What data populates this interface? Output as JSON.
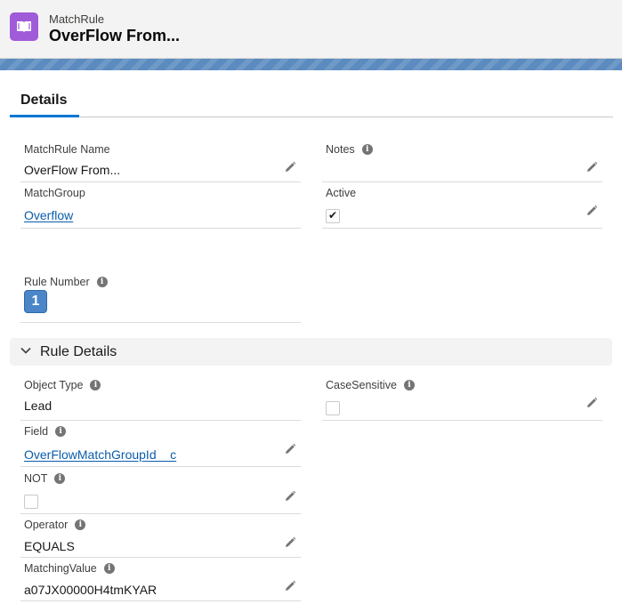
{
  "header": {
    "object_type": "MatchRule",
    "title": "OverFlow From..."
  },
  "tabs": {
    "details": "Details"
  },
  "fields": {
    "matchrule_name": {
      "label": "MatchRule Name",
      "value": "OverFlow From..."
    },
    "notes": {
      "label": "Notes",
      "value": ""
    },
    "matchgroup": {
      "label": "MatchGroup",
      "value": "Overflow"
    },
    "active": {
      "label": "Active",
      "checked": true
    },
    "rule_number": {
      "label": "Rule Number",
      "value": "1"
    }
  },
  "section": {
    "title": "Rule Details",
    "expanded": true
  },
  "rule_details": {
    "object_type": {
      "label": "Object Type",
      "value": "Lead"
    },
    "case_sensitive": {
      "label": "CaseSensitive",
      "checked": false
    },
    "field": {
      "label": "Field",
      "value": "OverFlowMatchGroupId__c"
    },
    "not": {
      "label": "NOT",
      "checked": false
    },
    "operator": {
      "label": "Operator",
      "value": "EQUALS"
    },
    "matching_value": {
      "label": "MatchingValue",
      "value": "a07JX00000H4tmKYAR"
    }
  },
  "colors": {
    "accent": "#0176d3",
    "icon_bg": "#a05bd8",
    "link": "#0b5cab"
  },
  "icons": {
    "info": "i",
    "edit": "pencil-icon",
    "object": "book-icon"
  }
}
